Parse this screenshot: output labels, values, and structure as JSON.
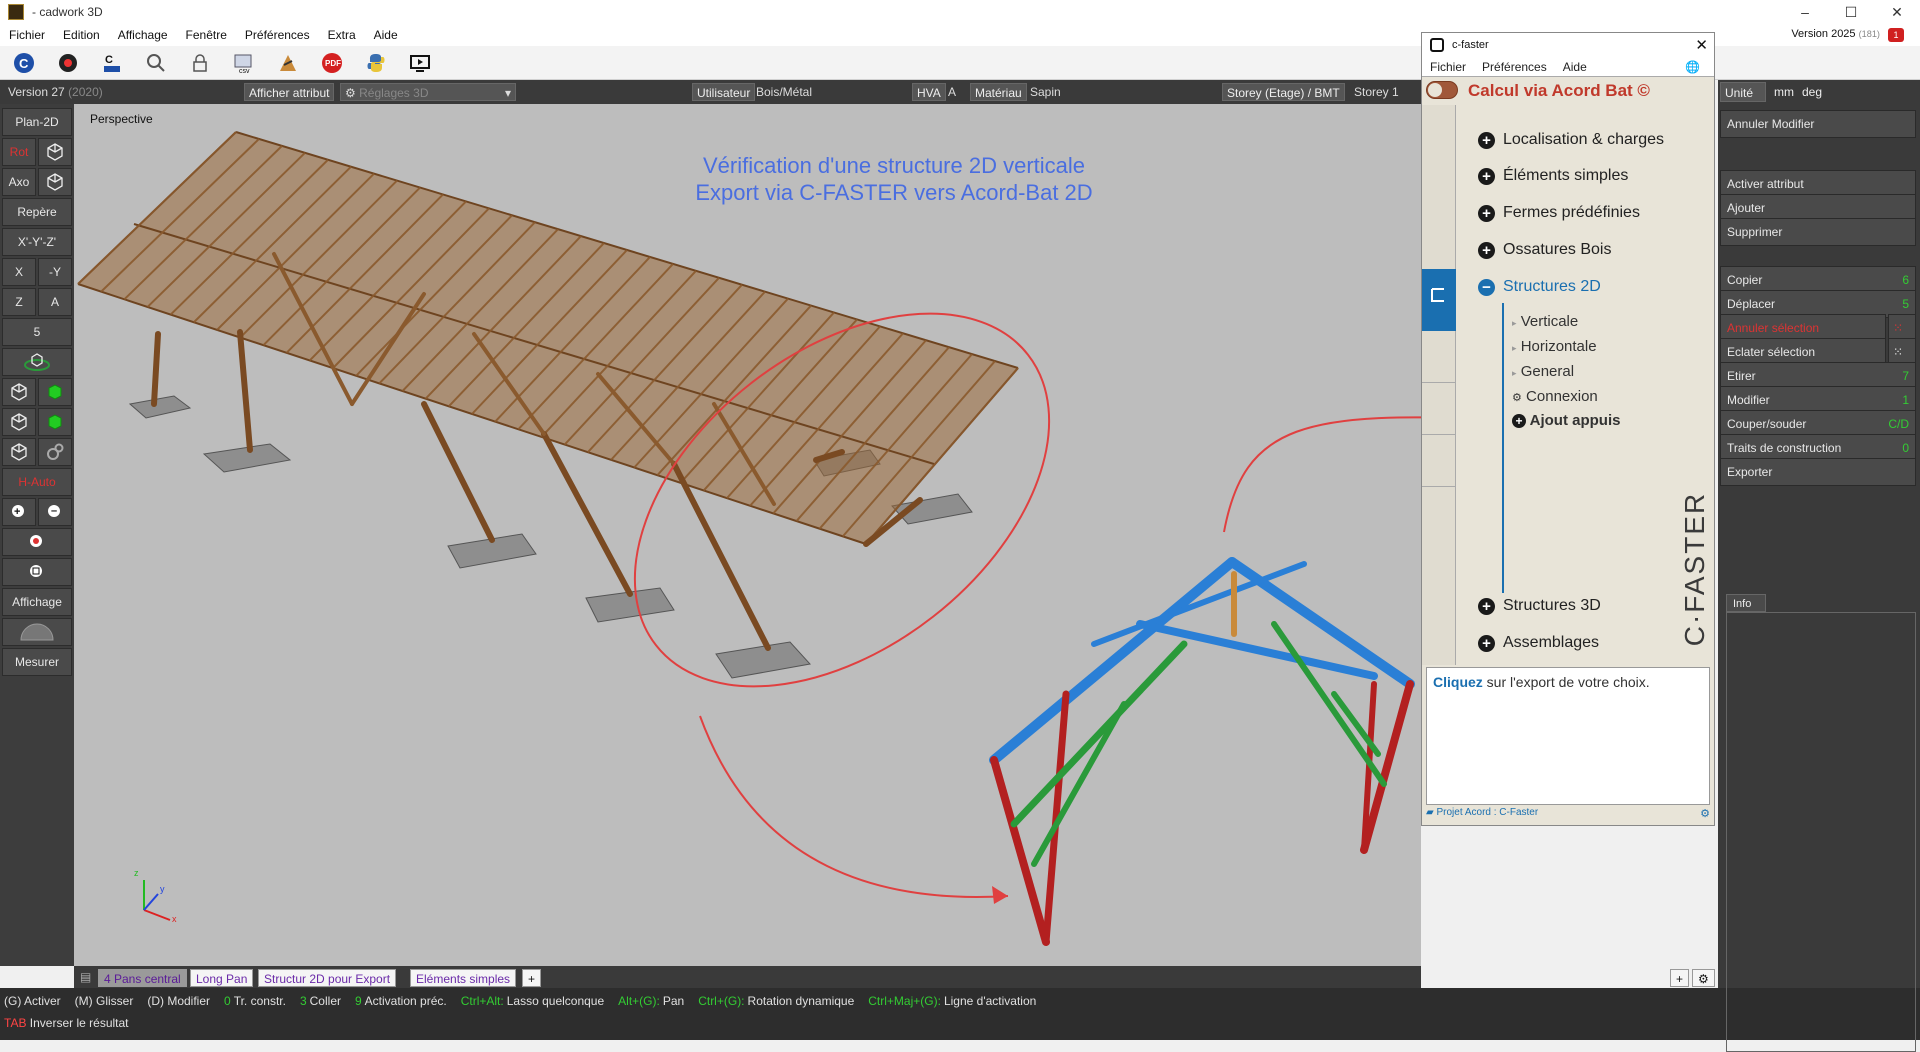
{
  "window": {
    "title": "- cadwork 3D"
  },
  "menu": [
    "Fichier",
    "Edition",
    "Affichage",
    "Fenêtre",
    "Préférences",
    "Extra",
    "Aide"
  ],
  "version_top": {
    "label": "Version 2025",
    "build": "(181)"
  },
  "notification_count": "1",
  "toolbar_icons": [
    "c-icon",
    "gear-icon",
    "c-faster-icon",
    "search-icon",
    "lock-icon",
    "csv-icon",
    "import-icon",
    "pdf-icon",
    "python-icon",
    "screen-icon"
  ],
  "infobar": {
    "version": "Version 27",
    "version_year": "(2020)",
    "afficher_attribut": "Afficher attribut",
    "reglages": "Réglages 3D",
    "utilisateur": "Utilisateur",
    "bois_metal": "Bois/Métal",
    "hva": "HVA",
    "a": "A",
    "materiau": "Matériau",
    "sapin": "Sapin",
    "storey": "Storey (Etage) / BMT",
    "storey_val": "Storey 1"
  },
  "left_toolbar": {
    "plan2d": "Plan-2D",
    "rot": "Rot",
    "axo": "Axo",
    "repere": "Repère",
    "xyz": "X'-Y'-Z'",
    "x": "X",
    "my": "-Y",
    "z": "Z",
    "a": "A",
    "five": "5",
    "auto": "H-Auto",
    "affichage": "Affichage",
    "mesurer": "Mesurer"
  },
  "viewport": {
    "perspective": "Perspective",
    "caption_line1": "Vérification d'une structure 2D verticale",
    "caption_line2": "Export via C-FASTER vers Acord-Bat 2D",
    "axis_x": "x",
    "axis_y": "y",
    "axis_z": "z"
  },
  "tabs": [
    "4 Pans central",
    "Long Pan",
    "Structur 2D pour Export",
    "Eléments simples",
    "+"
  ],
  "statusbar": {
    "row1": [
      {
        "t": "(G) Activer",
        "c": ""
      },
      {
        "t": "(M) Glisser",
        "c": ""
      },
      {
        "t": "(D) Modifier",
        "c": ""
      },
      {
        "t": "0",
        "c": "g"
      },
      {
        "t": "Tr. constr.",
        "c": ""
      },
      {
        "t": "3",
        "c": "g"
      },
      {
        "t": "Coller",
        "c": ""
      },
      {
        "t": "9",
        "c": "g"
      },
      {
        "t": "Activation préc.",
        "c": ""
      },
      {
        "t": "Ctrl+Alt:",
        "c": "g"
      },
      {
        "t": "Lasso quelconque",
        "c": ""
      },
      {
        "t": "Alt+(G):",
        "c": "g"
      },
      {
        "t": "Pan",
        "c": ""
      },
      {
        "t": "Ctrl+(G):",
        "c": "g"
      },
      {
        "t": "Rotation dynamique",
        "c": ""
      },
      {
        "t": "Ctrl+Maj+(G):",
        "c": "g"
      },
      {
        "t": "Ligne d'activation",
        "c": ""
      }
    ],
    "tab_key": "TAB",
    "tab_text": "Inverser le résultat"
  },
  "right_panel": {
    "unit": "Unité",
    "mm": "mm",
    "deg": "deg",
    "buttons": [
      {
        "label": "Annuler Modifier",
        "key": ""
      },
      {
        "label": "Activer attribut",
        "key": ""
      },
      {
        "label": "Ajouter",
        "key": ""
      },
      {
        "label": "Supprimer",
        "key": ""
      },
      {
        "label": "Copier",
        "key": "6"
      },
      {
        "label": "Déplacer",
        "key": "5"
      },
      {
        "label": "Annuler sélection",
        "key": ""
      },
      {
        "label": "Eclater sélection",
        "key": ""
      },
      {
        "label": "Etirer",
        "key": "7"
      },
      {
        "label": "Modifier",
        "key": "1"
      },
      {
        "label": "Couper/souder",
        "key": "C/D"
      },
      {
        "label": "Traits de construction",
        "key": "0"
      },
      {
        "label": "Exporter",
        "key": ""
      }
    ],
    "info": "Info"
  },
  "cfaster": {
    "title": "c-faster",
    "menu": [
      "Fichier",
      "Préférences",
      "Aide"
    ],
    "calc": "Calcul via Acord Bat ©",
    "items": [
      "Localisation & charges",
      "Éléments simples",
      "Fermes prédéfinies",
      "Ossatures Bois",
      "Structures 2D"
    ],
    "subitems": [
      "Verticale",
      "Horizontale",
      "General",
      "Connexion",
      "Ajout appuis"
    ],
    "items_bottom": [
      "Structures 3D",
      "Assemblages"
    ],
    "brand": "C·FASTER",
    "msg_bold": "Cliquez",
    "msg_rest": " sur l'export de votre choix.",
    "footer": "Projet Acord : C-Faster"
  },
  "colors": {
    "accent": "#1a6fb0",
    "timber": "#8a5a2e",
    "frame_blue": "#2a7fd6",
    "frame_green": "#2a9a3a",
    "frame_red": "#b32020",
    "arrow": "#e04040"
  }
}
